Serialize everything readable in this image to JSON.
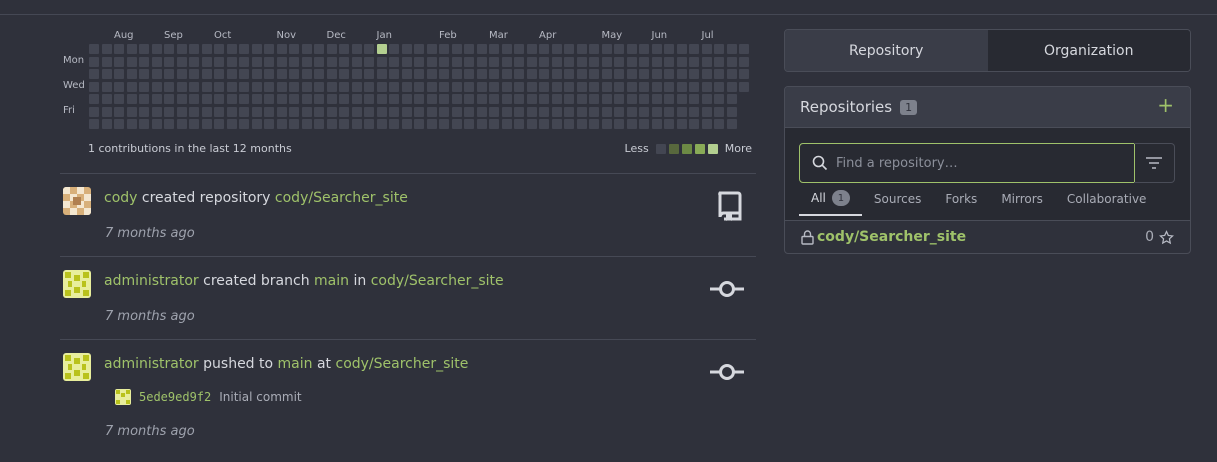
{
  "heatmap": {
    "months": [
      {
        "label": "Aug",
        "col": 2
      },
      {
        "label": "Sep",
        "col": 6
      },
      {
        "label": "Oct",
        "col": 10
      },
      {
        "label": "Nov",
        "col": 15
      },
      {
        "label": "Dec",
        "col": 19
      },
      {
        "label": "Jan",
        "col": 23
      },
      {
        "label": "Feb",
        "col": 28
      },
      {
        "label": "Mar",
        "col": 32
      },
      {
        "label": "Apr",
        "col": 36
      },
      {
        "label": "May",
        "col": 41
      },
      {
        "label": "Jun",
        "col": 45
      },
      {
        "label": "Jul",
        "col": 49
      }
    ],
    "days": [
      {
        "label": "Mon",
        "row": 1
      },
      {
        "label": "Wed",
        "row": 3
      },
      {
        "label": "Fri",
        "row": 5
      }
    ],
    "weeks": 53,
    "last_week_days": 4,
    "active": [
      {
        "week": 23,
        "day": 0,
        "level": 4
      }
    ],
    "summary": "1 contributions in the last 12 months",
    "less": "Less",
    "more": "More",
    "colors": [
      "#434652",
      "#58683d",
      "#6d8a45",
      "#89ab57",
      "#b3cf90"
    ]
  },
  "feed": [
    {
      "user": "cody",
      "action": "created repository",
      "parts": [
        "cody/Searcher_site"
      ],
      "time": "7 months ago",
      "icon": "repo-icon"
    },
    {
      "user": "administrator",
      "action": "created branch",
      "branch": "main",
      "joiner": "in",
      "repo": "cody/Searcher_site",
      "time": "7 months ago",
      "icon": "commit-icon"
    },
    {
      "user": "administrator",
      "action": "pushed to",
      "branch": "main",
      "joiner": "at",
      "repo": "cody/Searcher_site",
      "time": "7 months ago",
      "icon": "commit-icon",
      "commit": {
        "sha": "5ede9ed9f2",
        "message": "Initial commit"
      }
    }
  ],
  "switch": {
    "repository": "Repository",
    "organization": "Organization"
  },
  "repos": {
    "title": "Repositories",
    "count": "1",
    "search_placeholder": "Find a repository…",
    "tabs": [
      {
        "label": "All",
        "badge": "1"
      },
      {
        "label": "Sources"
      },
      {
        "label": "Forks"
      },
      {
        "label": "Mirrors"
      },
      {
        "label": "Collaborative"
      }
    ],
    "items": [
      {
        "name": "cody/Searcher_site",
        "stars": "0"
      }
    ]
  },
  "colors": {
    "accent": "#9fc26a",
    "bg": "#2f313b",
    "panel": "#3a3d48"
  }
}
